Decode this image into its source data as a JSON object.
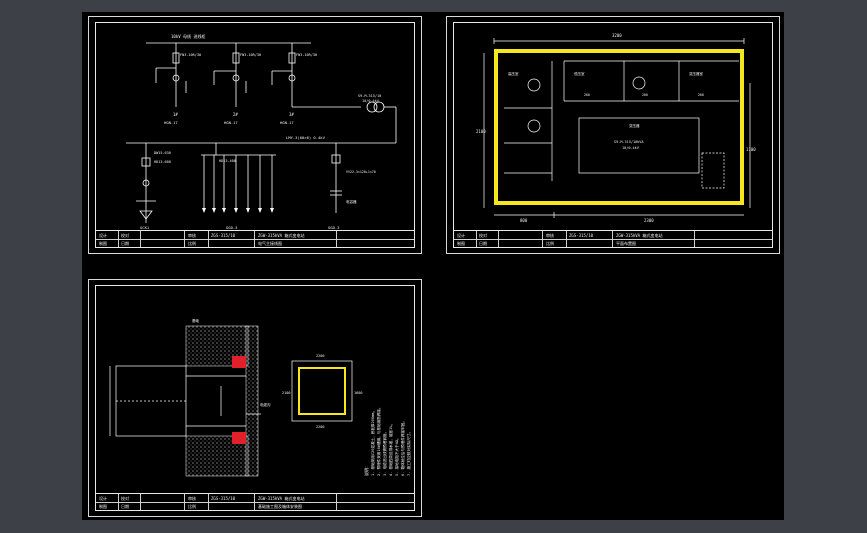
{
  "colors": {
    "background": "#3d4147",
    "viewport": "#000000",
    "line": "#ffffff",
    "highlight": "#f5e61e",
    "marker": "#e0202a"
  },
  "sheet1": {
    "busbar_top": "10kV 母线 进线柜",
    "lightning_label": "避雷器",
    "fuse_labels": [
      "FN3-10R/30",
      "FN3-10R/30",
      "FN3-10R/30"
    ],
    "switch_labels": [
      "1#",
      "2#",
      "3#"
    ],
    "switch_types": [
      "HGN-17",
      "HGN-17",
      "HGN-17"
    ],
    "ct_labels": [
      "LZZBJ9-10",
      "LZZBJ9-10",
      "LZZBJ9-10"
    ],
    "transformer_label": "S9-M-315/10",
    "transformer_sub": "10/0.4kV",
    "lv_busbar": "LMY-3(60×6) 0.4kV",
    "main_breaker": "DW15-630",
    "feeders_left": [
      "HD13-600",
      "HD13-400"
    ],
    "feeder_count_label": "出线",
    "capacitor": "电容器",
    "bottom_labels": [
      "GCK1",
      "GGD-3",
      "GGD-3"
    ],
    "cable_label": "VV22-3×120+1×70",
    "title": {
      "r1": [
        "设计",
        "校对",
        "审核",
        "工程名称",
        "ZGS-315/10",
        "ZGW-315kVA 箱式变电站"
      ],
      "r2": [
        "制图",
        "日期",
        "比例",
        "图号",
        "电气主接线图"
      ]
    }
  },
  "sheet2": {
    "dim_top": "3200",
    "dim_left": "2100",
    "dim_right": "1100",
    "dim_bottom": [
      "800",
      "2300"
    ],
    "room_labels": [
      "高压室",
      "低压室",
      "变压器室"
    ],
    "hv_panel": "高压柜",
    "lv_panel": "低压柜",
    "transformer_box": "变压器",
    "transformer_text": "S9-M-315/10kVA",
    "transformer_text2": "10/0.4kV",
    "dims_small": [
      "200",
      "200",
      "200",
      "900",
      "600",
      "300"
    ],
    "title": {
      "r1": [
        "设计",
        "校对",
        "审核",
        "工程名称",
        "ZGS-315/10",
        "ZGW-315kVA 箱式变电站"
      ],
      "r2": [
        "制图",
        "日期",
        "比例",
        "图号",
        "平面布置图"
      ]
    }
  },
  "sheet3": {
    "side_labels": [
      "基础",
      "电缆沟"
    ],
    "dim_box_top": "2200",
    "dim_box_left": "2100",
    "dim_box_bottom": "2200",
    "dim_box_right": "1600",
    "notes_title": "说明：",
    "notes": [
      "1. 基础采用C20混凝土，底板厚200mm。",
      "2. 预埋件采用10#槽钢，与基础钢筋焊接。",
      "3. 电缆进出线需预埋钢管。",
      "4. 基础四周设排水坡，坡度1%。",
      "5. 接地电阻不大于4Ω。",
      "6. 箱体就位后与预埋件焊接牢固。",
      "7. 施工时应核对实际尺寸。"
    ],
    "title": {
      "r1": [
        "设计",
        "校对",
        "审核",
        "工程名称",
        "ZGS-315/10",
        "ZGW-315kVA 箱式变电站"
      ],
      "r2": [
        "制图",
        "日期",
        "比例",
        "图号",
        "基础施工图及箱体安装图"
      ]
    }
  }
}
